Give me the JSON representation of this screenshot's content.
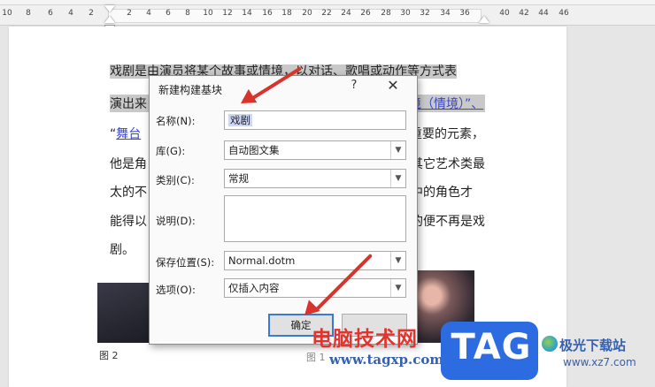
{
  "ruler": {
    "left_numbers": [
      "10",
      "8",
      "6",
      "4",
      "2"
    ],
    "right_numbers": [
      "2",
      "4",
      "6",
      "8",
      "10",
      "12",
      "14",
      "16",
      "18",
      "20",
      "22",
      "24",
      "26",
      "28",
      "30",
      "32",
      "34",
      "36",
      "40",
      "42",
      "44",
      "46"
    ]
  },
  "document": {
    "lines": [
      {
        "text": "戏剧是由演员将某个故事或情境，以对话、歌唱或动作等方式表"
      },
      {
        "pre": "演出来",
        "link": "境（情境）”、"
      },
      {
        "pre": "“",
        "link": "舞台",
        "post": "重要的元素，"
      },
      {
        "pre": "他是角",
        "post": "其它艺术类最"
      },
      {
        "pre": "太的不",
        "post": "中的角色才"
      },
      {
        "pre": "能得以",
        "post": "的便不再是戏"
      },
      {
        "text": "剧。"
      }
    ],
    "caption_left": "图 2",
    "caption_right": "图 1"
  },
  "dialog": {
    "title": "新建构建基块",
    "help": "?",
    "close": "✕",
    "fields": {
      "name_label": "名称(N):",
      "name_value": "戏剧",
      "gallery_label": "库(G):",
      "gallery_value": "自动图文集",
      "category_label": "类别(C):",
      "category_value": "常规",
      "description_label": "说明(D):",
      "description_value": "",
      "save_label": "保存位置(S):",
      "save_value": "Normal.dotm",
      "options_label": "选项(O):",
      "options_value": "仅插入内容"
    },
    "ok_button": "确定",
    "dropdown_icon": "chevron-down-icon"
  },
  "watermark": {
    "site_cn": "电脑技术网",
    "site_url": "www.tagxp.com",
    "tag": "TAG",
    "jg_cn": "极光下载站",
    "jg_url": "www.xz7.com"
  },
  "colors": {
    "accent_red": "#d9342b",
    "ok_border": "#3b79d6",
    "tag_blue": "#2c6be0",
    "link": "#3a47c9"
  }
}
